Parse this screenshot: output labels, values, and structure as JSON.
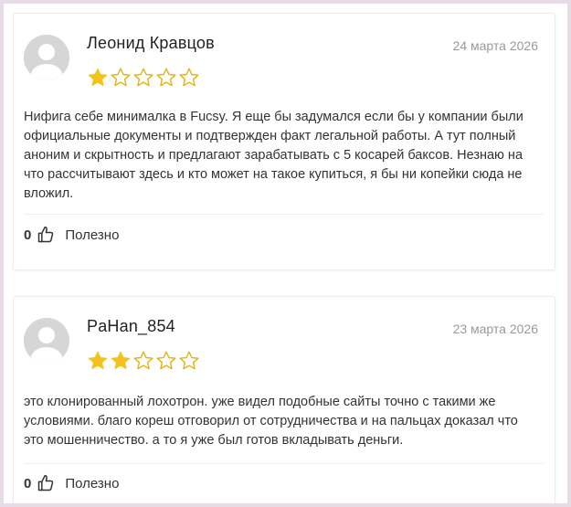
{
  "reviews": [
    {
      "author": "Леонид Кравцов",
      "date": "24 марта 2026",
      "rating": 1,
      "max_rating": 5,
      "text": "Нифига себе минималка в Fucsy. Я еще бы задумался если бы у компании были официальные документы и подтвержден факт легальной работы. А тут полный аноним и скрытность и предлагают зарабатывать с 5 косарей баксов. Незнаю на что рассчитывают здесь и кто может на такое купиться, я бы ни копейки сюда не вложил.",
      "helpful_count": "0",
      "helpful_label": "Полезно"
    },
    {
      "author": "PaHan_854",
      "date": "23 марта 2026",
      "rating": 2,
      "max_rating": 5,
      "text": "это клонированный лохотрон. уже видел подобные сайты точно с такими же условиями. благо кореш отговорил от сотрудничества и на пальцах доказал что это мошенничество. а то я уже был готов вкладывать деньги.",
      "helpful_count": "0",
      "helpful_label": "Полезно"
    }
  ],
  "colors": {
    "star_filled": "#f2c31b",
    "star_outline": "#e0b416",
    "frame": "#e7dbe7"
  },
  "icons": {
    "avatar": "user-avatar-placeholder-icon",
    "helpful": "thumbs-up-icon"
  }
}
